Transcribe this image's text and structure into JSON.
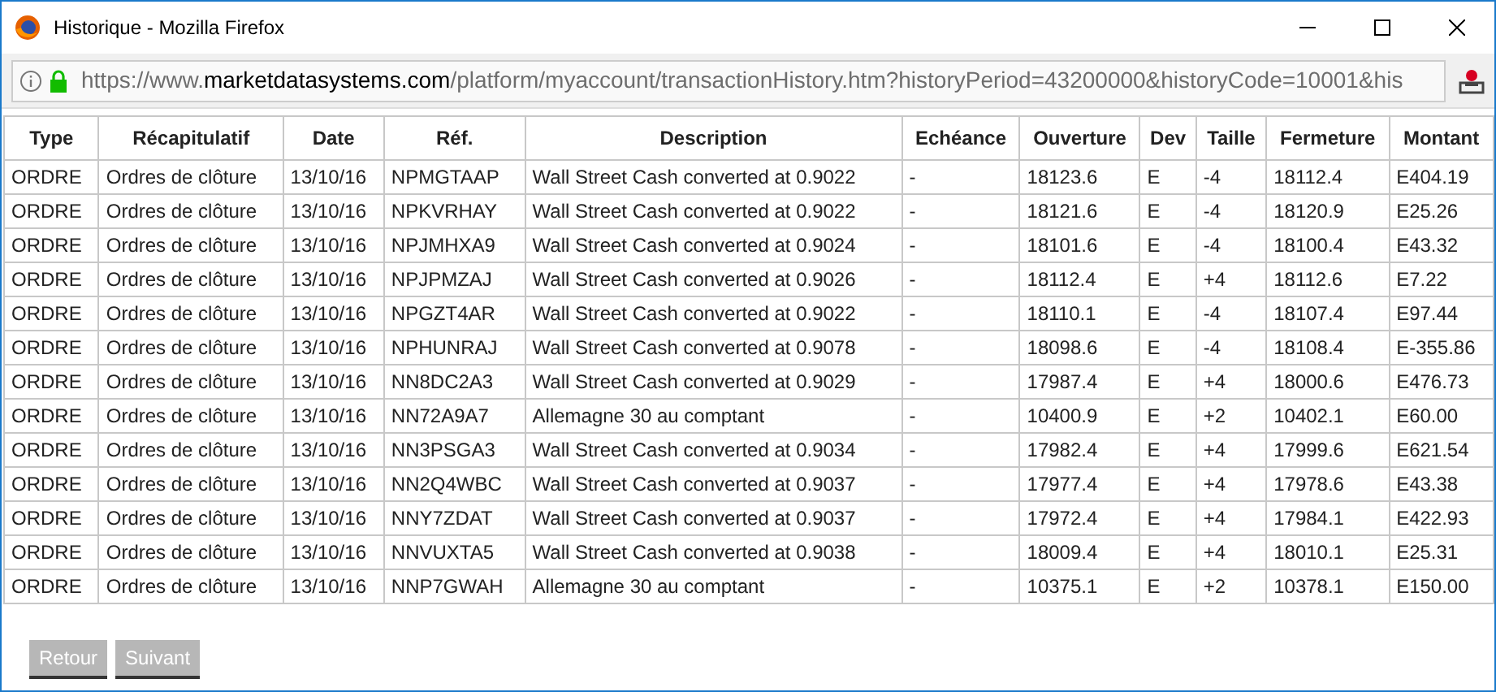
{
  "window": {
    "title": "Historique - Mozilla Firefox"
  },
  "address_bar": {
    "url_prefix": "https://www.",
    "url_domain": "marketdatasystems.com",
    "url_path": "/platform/myaccount/transactionHistory.htm?historyPeriod=43200000&historyCode=10001&his"
  },
  "table": {
    "columns": [
      "Type",
      "Récapitulatif",
      "Date",
      "Réf.",
      "Description",
      "Echéance",
      "Ouverture",
      "Dev",
      "Taille",
      "Fermeture",
      "Montant"
    ],
    "rows": [
      [
        "ORDRE",
        "Ordres de clôture",
        "13/10/16",
        "NPMGTAAP",
        "Wall Street Cash converted at 0.9022",
        "-",
        "18123.6",
        "E",
        "-4",
        "18112.4",
        "E404.19"
      ],
      [
        "ORDRE",
        "Ordres de clôture",
        "13/10/16",
        "NPKVRHAY",
        "Wall Street Cash converted at 0.9022",
        "-",
        "18121.6",
        "E",
        "-4",
        "18120.9",
        "E25.26"
      ],
      [
        "ORDRE",
        "Ordres de clôture",
        "13/10/16",
        "NPJMHXA9",
        "Wall Street Cash converted at 0.9024",
        "-",
        "18101.6",
        "E",
        "-4",
        "18100.4",
        "E43.32"
      ],
      [
        "ORDRE",
        "Ordres de clôture",
        "13/10/16",
        "NPJPMZAJ",
        "Wall Street Cash converted at 0.9026",
        "-",
        "18112.4",
        "E",
        "+4",
        "18112.6",
        "E7.22"
      ],
      [
        "ORDRE",
        "Ordres de clôture",
        "13/10/16",
        "NPGZT4AR",
        "Wall Street Cash converted at 0.9022",
        "-",
        "18110.1",
        "E",
        "-4",
        "18107.4",
        "E97.44"
      ],
      [
        "ORDRE",
        "Ordres de clôture",
        "13/10/16",
        "NPHUNRAJ",
        "Wall Street Cash converted at 0.9078",
        "-",
        "18098.6",
        "E",
        "-4",
        "18108.4",
        "E-355.86"
      ],
      [
        "ORDRE",
        "Ordres de clôture",
        "13/10/16",
        "NN8DC2A3",
        "Wall Street Cash converted at 0.9029",
        "-",
        "17987.4",
        "E",
        "+4",
        "18000.6",
        "E476.73"
      ],
      [
        "ORDRE",
        "Ordres de clôture",
        "13/10/16",
        "NN72A9A7",
        "Allemagne 30 au comptant",
        "-",
        "10400.9",
        "E",
        "+2",
        "10402.1",
        "E60.00"
      ],
      [
        "ORDRE",
        "Ordres de clôture",
        "13/10/16",
        "NN3PSGA3",
        "Wall Street Cash converted at 0.9034",
        "-",
        "17982.4",
        "E",
        "+4",
        "17999.6",
        "E621.54"
      ],
      [
        "ORDRE",
        "Ordres de clôture",
        "13/10/16",
        "NN2Q4WBC",
        "Wall Street Cash converted at 0.9037",
        "-",
        "17977.4",
        "E",
        "+4",
        "17978.6",
        "E43.38"
      ],
      [
        "ORDRE",
        "Ordres de clôture",
        "13/10/16",
        "NNY7ZDAT",
        "Wall Street Cash converted at 0.9037",
        "-",
        "17972.4",
        "E",
        "+4",
        "17984.1",
        "E422.93"
      ],
      [
        "ORDRE",
        "Ordres de clôture",
        "13/10/16",
        "NNVUXTA5",
        "Wall Street Cash converted at 0.9038",
        "-",
        "18009.4",
        "E",
        "+4",
        "18010.1",
        "E25.31"
      ],
      [
        "ORDRE",
        "Ordres de clôture",
        "13/10/16",
        "NNP7GWAH",
        "Allemagne 30 au comptant",
        "-",
        "10375.1",
        "E",
        "+2",
        "10378.1",
        "E150.00"
      ]
    ]
  },
  "buttons": [
    {
      "label": "Retour",
      "disabled": true
    },
    {
      "label": "Suivant",
      "disabled": true
    }
  ]
}
